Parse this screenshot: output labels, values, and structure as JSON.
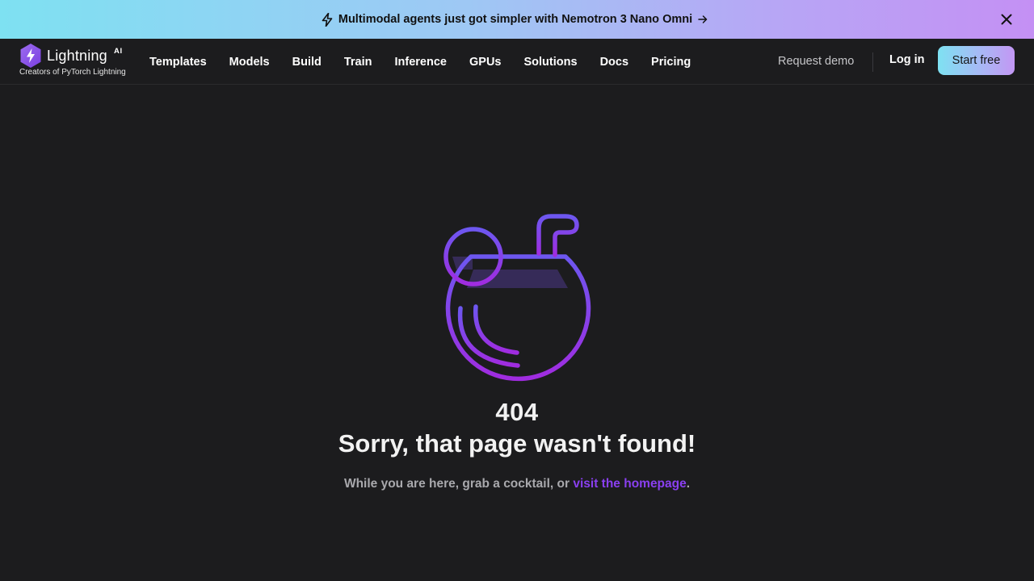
{
  "banner": {
    "text": "Multimodal agents just got simpler with Nemotron 3 Nano Omni",
    "icons": [
      "lightning-icon",
      "arrow-right-icon",
      "close-icon"
    ]
  },
  "navbar": {
    "logo_text": "Lightning",
    "logo_badge": "AI",
    "tagline": "Creators of PyTorch Lightning",
    "links": [
      "Templates",
      "Models",
      "Build",
      "Train",
      "Inference",
      "GPUs",
      "Solutions",
      "Docs",
      "Pricing"
    ],
    "request_demo": "Request demo",
    "login": "Log in",
    "cta": "Start free"
  },
  "main": {
    "code": "404",
    "headline": "Sorry, that page wasn't found!",
    "subtext_before": "While you are here, grab a cocktail, or ",
    "link_text": "visit the homepage",
    "subtext_after": ".",
    "illustration": "coconut-cocktail-icon"
  },
  "colors": {
    "background": "#1c1c1e",
    "accent_purple": "#8a3ff0",
    "banner_gradient_start": "#7ee1f2",
    "banner_gradient_end": "#c490f4"
  }
}
